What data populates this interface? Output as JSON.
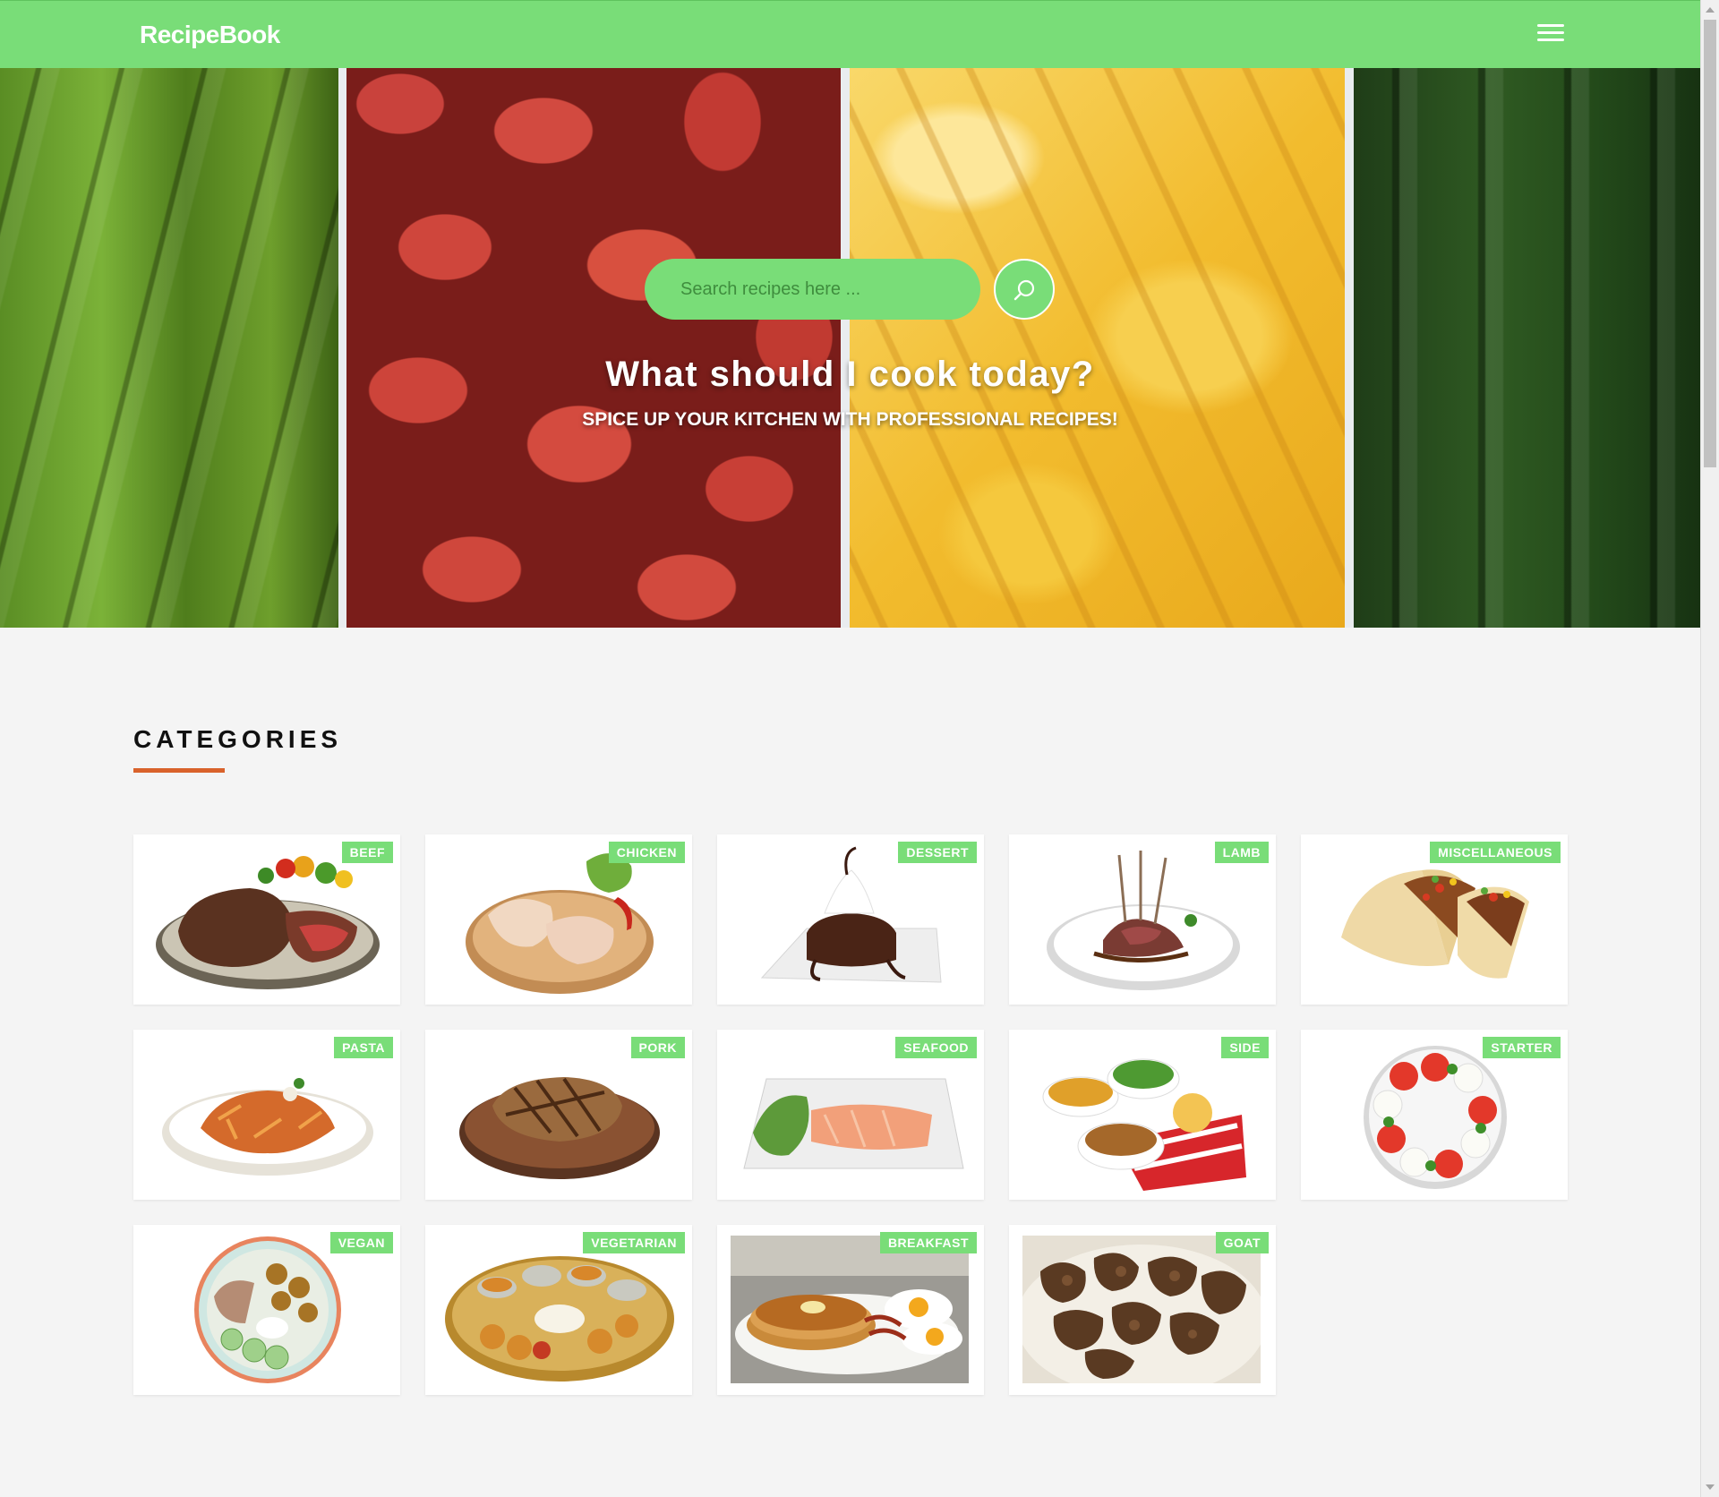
{
  "navbar": {
    "brand": "RecipeBook",
    "menu_icon": "hamburger-icon"
  },
  "hero": {
    "search_placeholder": "Search recipes here ...",
    "search_icon": "search-icon",
    "title": "What should I cook today?",
    "subtitle": "SPICE UP YOUR KITCHEN WITH PROFESSIONAL RECIPES!"
  },
  "categories": {
    "title": "CATEGORIES",
    "accent_color": "#d9622b",
    "badge_color": "#79dd78",
    "items": [
      {
        "label": "BEEF"
      },
      {
        "label": "CHICKEN"
      },
      {
        "label": "DESSERT"
      },
      {
        "label": "LAMB"
      },
      {
        "label": "MISCELLANEOUS"
      },
      {
        "label": "PASTA"
      },
      {
        "label": "PORK"
      },
      {
        "label": "SEAFOOD"
      },
      {
        "label": "SIDE"
      },
      {
        "label": "STARTER"
      },
      {
        "label": "VEGAN"
      },
      {
        "label": "VEGETARIAN"
      },
      {
        "label": "BREAKFAST"
      },
      {
        "label": "GOAT"
      }
    ]
  },
  "theme": {
    "primary": "#79dd78",
    "background": "#f4f4f4"
  }
}
